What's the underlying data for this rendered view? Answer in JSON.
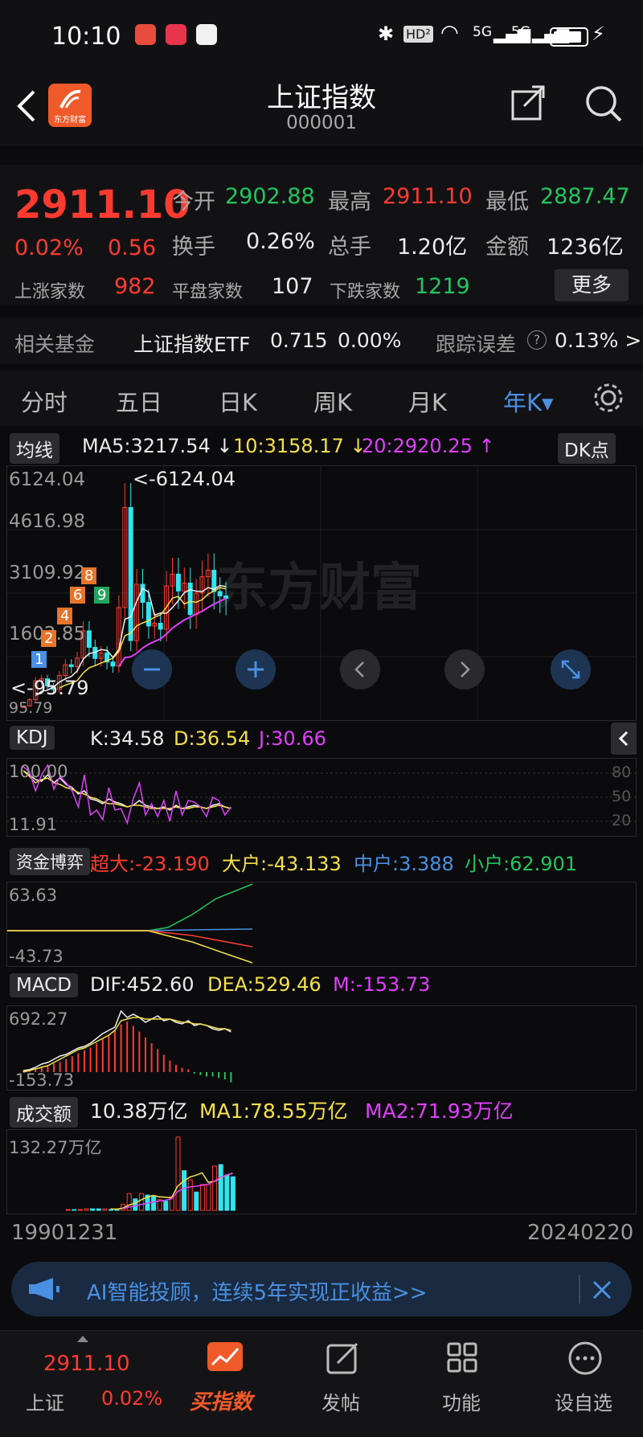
{
  "status_bar": {
    "time": "10:10",
    "badges": [
      "HD²",
      "5G",
      "5G"
    ]
  },
  "header": {
    "title": "上证指数",
    "code": "000001",
    "logo_text": "东方财富"
  },
  "quote": {
    "price": "2911.10",
    "change_pct": "0.02%",
    "change": "0.56",
    "open_label": "今开",
    "open": "2902.88",
    "high_label": "最高",
    "high": "2911.10",
    "low_label": "最低",
    "low": "2887.47",
    "turnover_label": "换手",
    "turnover": "0.26%",
    "volume_label": "总手",
    "volume": "1.20亿",
    "amount_label": "金额",
    "amount": "1236亿",
    "up_label": "上涨家数",
    "up": "982",
    "flat_label": "平盘家数",
    "flat": "107",
    "down_label": "下跌家数",
    "down": "1219",
    "more": "更多"
  },
  "fund": {
    "label": "相关基金",
    "name": "上证指数ETF",
    "price": "0.715",
    "pct": "0.00%",
    "err_label": "跟踪误差",
    "err": "0.13% >"
  },
  "tabs": [
    "分时",
    "五日",
    "日K",
    "周K",
    "月K",
    "年K",
    "年K▾"
  ],
  "kline": {
    "ma_btn": "均线",
    "ma5": "MA5:3217.54 ↓",
    "ma10": "10:3158.17 ↓",
    "ma20": "20:2920.25 ↑",
    "dk_btn": "DK点",
    "y_labels": [
      "6124.04",
      "4616.98",
      "3109.92",
      "1602.85",
      "95.79"
    ],
    "max_marker": "<-6124.04",
    "min_marker": "<-95.79",
    "watermark": "东方财富",
    "td_labels": [
      "8",
      "6",
      "4",
      "2",
      "1",
      "9"
    ]
  },
  "kdj": {
    "btn": "KDJ",
    "k": "K:34.58",
    "d": "D:36.54",
    "j": "J:30.66",
    "y_top": "100.00",
    "y_bottom": "11.91",
    "right": [
      "80",
      "50",
      "20"
    ]
  },
  "flow": {
    "btn": "资金博弈",
    "super": "超大:-23.190",
    "big": "大户:-43.133",
    "mid": "中户:3.388",
    "small": "小户:62.901",
    "y_top": "63.63",
    "y_bottom": "-43.73"
  },
  "macd": {
    "btn": "MACD",
    "dif": "DIF:452.60",
    "dea": "DEA:529.46",
    "m": "M:-153.73",
    "y_top": "692.27",
    "y_bottom": "-153.73"
  },
  "vol": {
    "btn": "成交额",
    "cur": "10.38万亿",
    "ma1": "MA1:78.55万亿",
    "ma2": "MA2:71.93万亿",
    "y_top": "132.27万亿"
  },
  "dates": {
    "start": "19901231",
    "end": "20240220"
  },
  "ad": {
    "text": "AI智能投顾，连续5年实现正收益>>"
  },
  "nav": {
    "price": "2911.10",
    "pct": "0.02%",
    "name": "上证",
    "buy": "买指数",
    "post": "发帖",
    "func": "功能",
    "watch": "设自选"
  },
  "colors": {
    "up": "#ff3b30",
    "down": "#22c55e",
    "cyan": "#2fe6f0",
    "yellow": "#f5e04a",
    "magenta": "#e040fb"
  }
}
